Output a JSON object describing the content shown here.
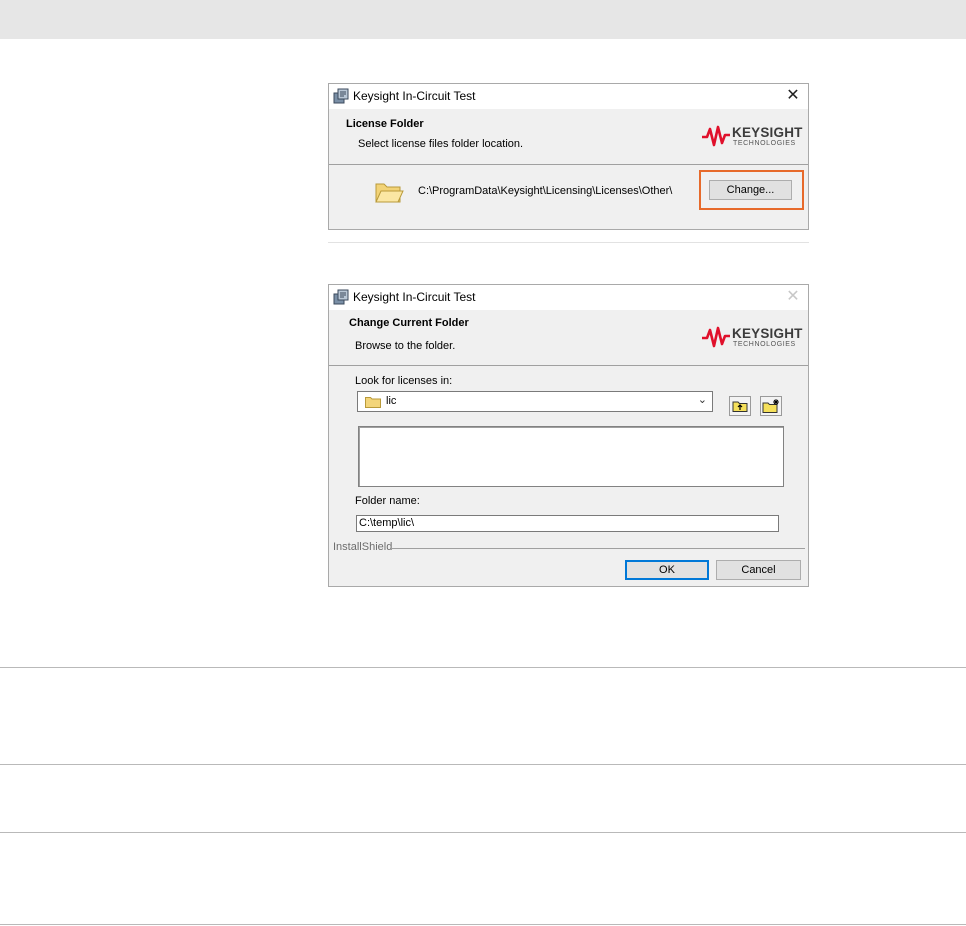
{
  "dialog1": {
    "title": "Keysight In-Circuit Test",
    "banner_title": "License Folder",
    "banner_subtitle": "Select license files folder location.",
    "logo_word": "KEYSIGHT",
    "logo_sub": "TECHNOLOGIES",
    "folder_path": "C:\\ProgramData\\Keysight\\Licensing\\Licenses\\Other\\",
    "change_button": "Change..."
  },
  "dialog2": {
    "title": "Keysight In-Circuit Test",
    "banner_title": "Change Current Folder",
    "banner_subtitle": "Browse to the folder.",
    "logo_word": "KEYSIGHT",
    "logo_sub": "TECHNOLOGIES",
    "look_in_label": "Look for licenses in:",
    "look_in_value": "lic",
    "folder_name_label": "Folder name:",
    "folder_name_value": "C:\\temp\\lic\\",
    "installshield_label": "InstallShield",
    "ok_button": "OK",
    "cancel_button": "Cancel"
  },
  "colors": {
    "highlight": "#e76a2b",
    "logo_red": "#e0102b",
    "default_button_border": "#0078d7"
  }
}
